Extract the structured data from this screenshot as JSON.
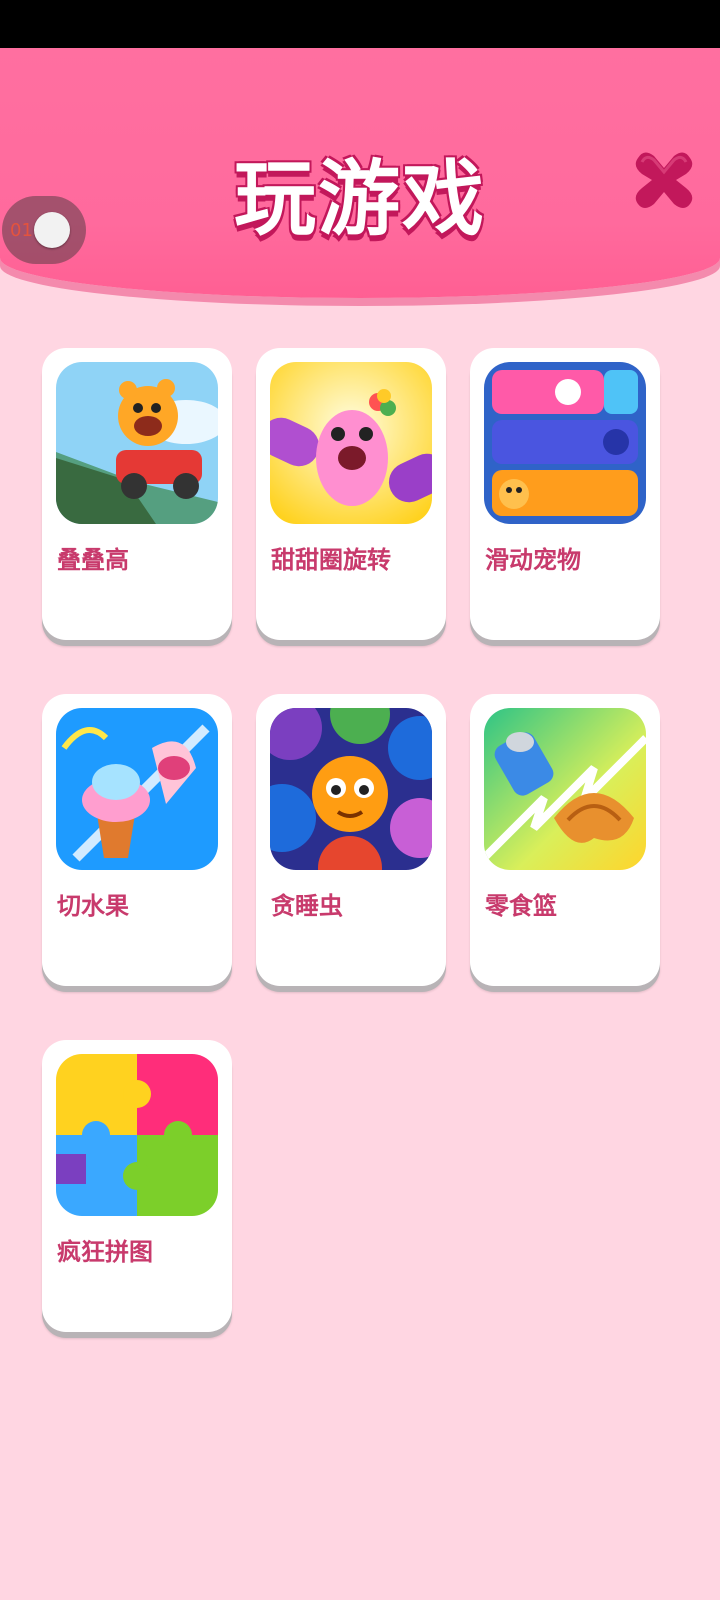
{
  "header": {
    "title": "玩游戏",
    "close_icon": "close-x-icon",
    "toggle_label": "01"
  },
  "colors": {
    "header_bg": "#ff6a9d",
    "page_bg": "#ffd6e2",
    "label": "#c83a6c",
    "close": "#c2185b"
  },
  "games": [
    {
      "label": "叠叠高",
      "icon": "car-bear-icon"
    },
    {
      "label": "甜甜圈旋转",
      "icon": "unicorn-donut-icon"
    },
    {
      "label": "滑动宠物",
      "icon": "slide-pets-icon"
    },
    {
      "label": "切水果",
      "icon": "cupcake-slice-icon"
    },
    {
      "label": "贪睡虫",
      "icon": "sleepy-bug-icon"
    },
    {
      "label": "零食篮",
      "icon": "snack-basket-icon"
    },
    {
      "label": "疯狂拼图",
      "icon": "puzzle-icon"
    }
  ]
}
